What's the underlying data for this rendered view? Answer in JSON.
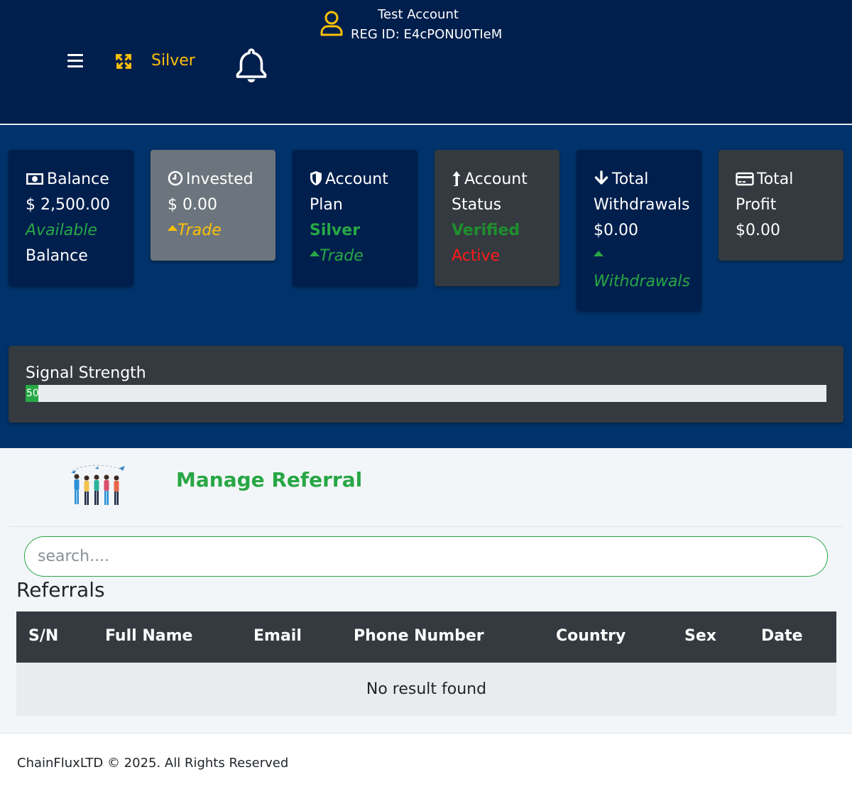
{
  "header": {
    "plan_name": "Silver",
    "account_name": "Test Account",
    "reg_id": "REG ID: E4cPONU0TIeM",
    "icons": [
      "menu-icon",
      "expand-icon",
      "bell-icon",
      "user-icon"
    ],
    "colors": {
      "background": "#001f4d",
      "accent": "#ffc107"
    }
  },
  "cards": {
    "balance": {
      "title": "Balance",
      "amount": "$ 2,500.00",
      "sub1": "Available",
      "sub2": "Balance"
    },
    "invested": {
      "title": "Invested",
      "amount": "$ 0.00",
      "sub": "Trade"
    },
    "plan": {
      "title1": "Account",
      "title2": "Plan",
      "value": "Silver",
      "sub": "Trade"
    },
    "status": {
      "title1": "Account",
      "title2": "Status",
      "verified": "Verified",
      "active": "Active"
    },
    "withdrawals": {
      "title1": "Total",
      "title2": "Withdrawals",
      "amount": "$0.00",
      "sub": "Withdrawals"
    },
    "profit": {
      "title1": "Total",
      "title2": "Profit",
      "amount": "$0.00"
    }
  },
  "signal": {
    "title": "Signal Strength",
    "value_label": "50",
    "level_fraction": 0.016
  },
  "referral": {
    "title": "Manage Referral",
    "search_placeholder": "search....",
    "subtitle": "Referrals",
    "columns": [
      "S/N",
      "Full Name",
      "Email",
      "Phone Number",
      "Country",
      "Sex",
      "Date"
    ],
    "empty_text": "No result found"
  },
  "footer": {
    "text": "ChainFluxLTD © 2025. All Rights Reserved"
  }
}
